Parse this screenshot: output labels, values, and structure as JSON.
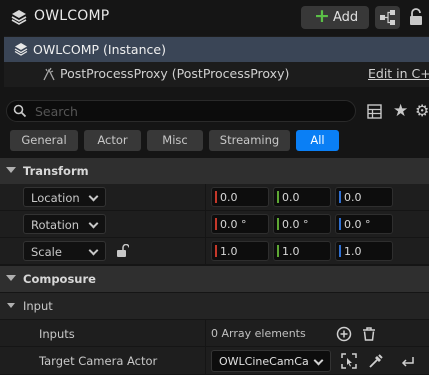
{
  "header": {
    "title": "OWLCOMP",
    "add_label": "Add"
  },
  "tree": {
    "root_label": "OWLCOMP (Instance)",
    "child_label": "PostProcessProxy (PostProcessProxy)",
    "edit_link": "Edit in C++"
  },
  "search": {
    "placeholder": "Search"
  },
  "tabs": [
    "General",
    "Actor",
    "Misc",
    "Streaming",
    "All"
  ],
  "active_tab": "All",
  "sections": {
    "transform": "Transform",
    "composure": "Composure",
    "input": "Input"
  },
  "transform": {
    "location": {
      "label": "Location",
      "x": "0.0",
      "y": "0.0",
      "z": "0.0"
    },
    "rotation": {
      "label": "Rotation",
      "x": "0.0 °",
      "y": "0.0 °",
      "z": "0.0 °"
    },
    "scale": {
      "label": "Scale",
      "x": "1.0",
      "y": "1.0",
      "z": "1.0"
    }
  },
  "input": {
    "inputs_label": "Inputs",
    "inputs_value": "0 Array elements",
    "target_label": "Target Camera Actor",
    "target_value": "OWLCineCamCapture"
  },
  "colors": {
    "accent": "#0a7ff5",
    "x_axis": "#c5382a",
    "y_axis": "#5ea834",
    "z_axis": "#2f6fd1",
    "selection": "#3a4556"
  }
}
